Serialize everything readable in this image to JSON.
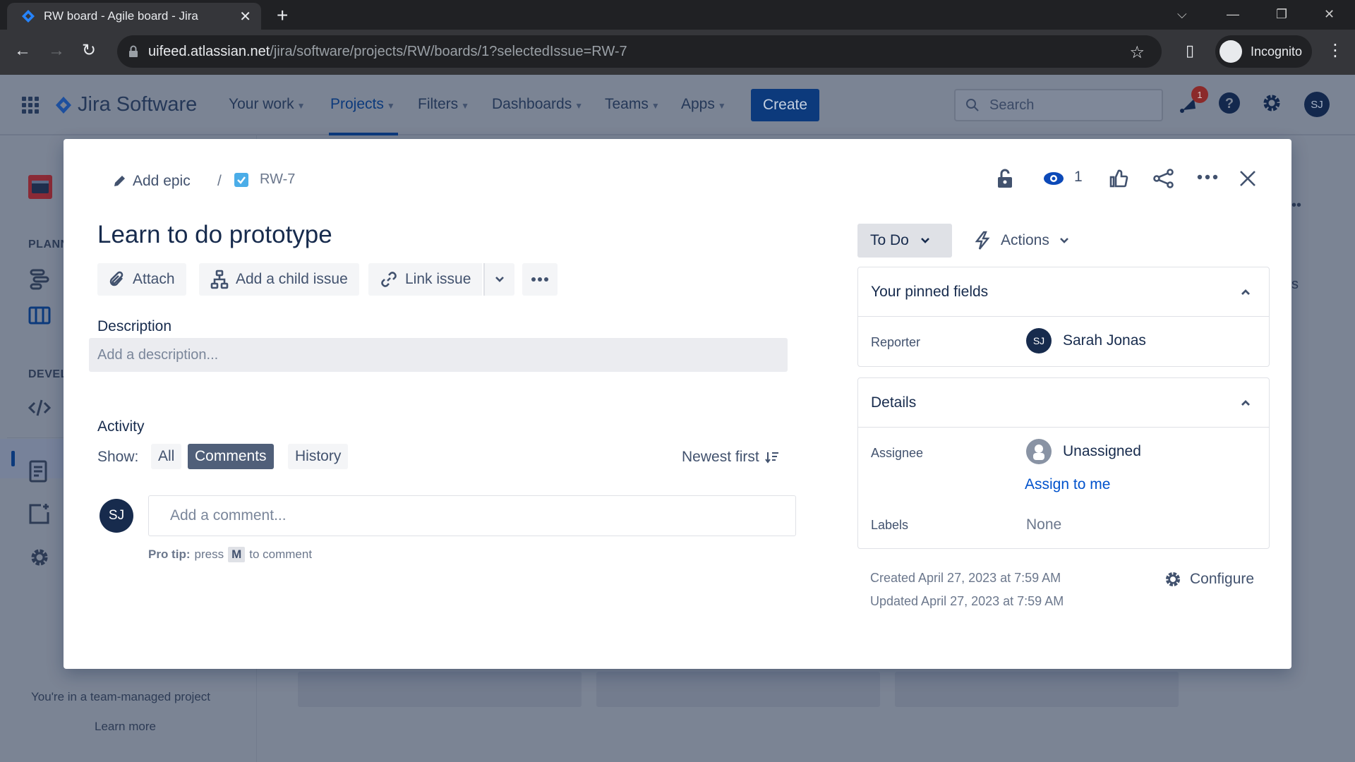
{
  "browser": {
    "tab_title": "RW board - Agile board - Jira",
    "url_host": "uifeed.atlassian.net",
    "url_path": "/jira/software/projects/RW/boards/1?selectedIssue=RW-7",
    "profile_label": "Incognito"
  },
  "jira_header": {
    "product_name": "Jira Software",
    "nav": [
      {
        "label": "Your work"
      },
      {
        "label": "Projects"
      },
      {
        "label": "Filters"
      },
      {
        "label": "Dashboards"
      },
      {
        "label": "Teams"
      },
      {
        "label": "Apps"
      }
    ],
    "create_label": "Create",
    "search_placeholder": "Search",
    "notification_count": "1",
    "user_initials": "SJ"
  },
  "sidebar": {
    "section_planning": "PLANN",
    "section_development": "DEVEL",
    "footer_text": "You're in a team-managed project",
    "learn_more": "Learn more"
  },
  "background": {
    "right_edge_text": "s"
  },
  "issue": {
    "breadcrumb_epic": "Add epic",
    "breadcrumb_sep": "/",
    "key": "RW-7",
    "title": "Learn to do prototype",
    "watch_count": "1",
    "toolbar": {
      "attach": "Attach",
      "add_child": "Add a child issue",
      "link_issue": "Link issue"
    },
    "description_label": "Description",
    "description_placeholder": "Add a description...",
    "activity": {
      "label": "Activity",
      "show_label": "Show:",
      "filters": [
        "All",
        "Comments",
        "History"
      ],
      "active_filter": "Comments",
      "sort_label": "Newest first",
      "commenter_initials": "SJ",
      "comment_placeholder": "Add a comment...",
      "protip_bold": "Pro tip:",
      "protip_pre": "press",
      "protip_key": "M",
      "protip_post": "to comment"
    },
    "status": "To Do",
    "actions_label": "Actions",
    "pinned": {
      "title": "Your pinned fields",
      "reporter_label": "Reporter",
      "reporter_initials": "SJ",
      "reporter_name": "Sarah Jonas"
    },
    "details": {
      "title": "Details",
      "assignee_label": "Assignee",
      "assignee_value": "Unassigned",
      "assign_to_me": "Assign to me",
      "labels_label": "Labels",
      "labels_value": "None"
    },
    "created": "Created April 27, 2023 at 7:59 AM",
    "updated": "Updated April 27, 2023 at 7:59 AM",
    "configure_label": "Configure"
  }
}
